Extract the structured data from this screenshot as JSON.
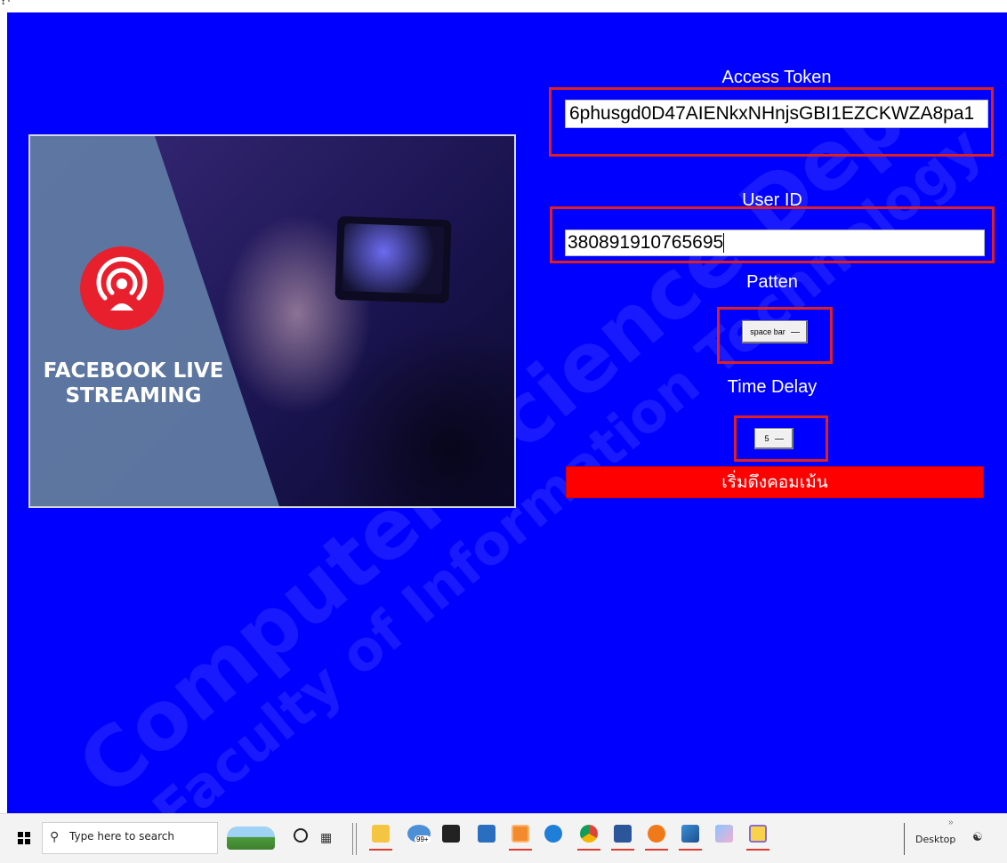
{
  "window": {
    "title_glyph": "ɪ ᵛ"
  },
  "hero": {
    "caption_line1": "FACEBOOK LIVE",
    "caption_line2": "STREAMING"
  },
  "form": {
    "access_token_label": "Access Token",
    "access_token_value": "6phusgd0D47AIENkxNHnjsGBI1EZCKWZA8pa1",
    "user_id_label": "User ID",
    "user_id_value": "380891910765695",
    "pattern_label": "Patten",
    "pattern_selected": "space bar",
    "time_delay_label": "Time Delay",
    "time_delay_selected": "5",
    "start_button_label": "เริ่มดึงคอมเม้น"
  },
  "watermark": {
    "line1": "Computer Science Dep",
    "line2": "Faculty of Information Technology"
  },
  "taskbar": {
    "search_placeholder": "Type here to search",
    "desktop_label": "Desktop",
    "mail_badge": "99+",
    "overflow_chevron": "»",
    "apps": [
      "file-explorer",
      "mail",
      "notion",
      "store",
      "line",
      "edge",
      "chrome",
      "word",
      "vpn",
      "photos",
      "paint",
      "sticky-notes"
    ]
  },
  "colors": {
    "app_background": "#0000ff",
    "highlight_frame": "#e02020",
    "start_button": "#ff0000",
    "live_icon_red": "#e8202e"
  }
}
